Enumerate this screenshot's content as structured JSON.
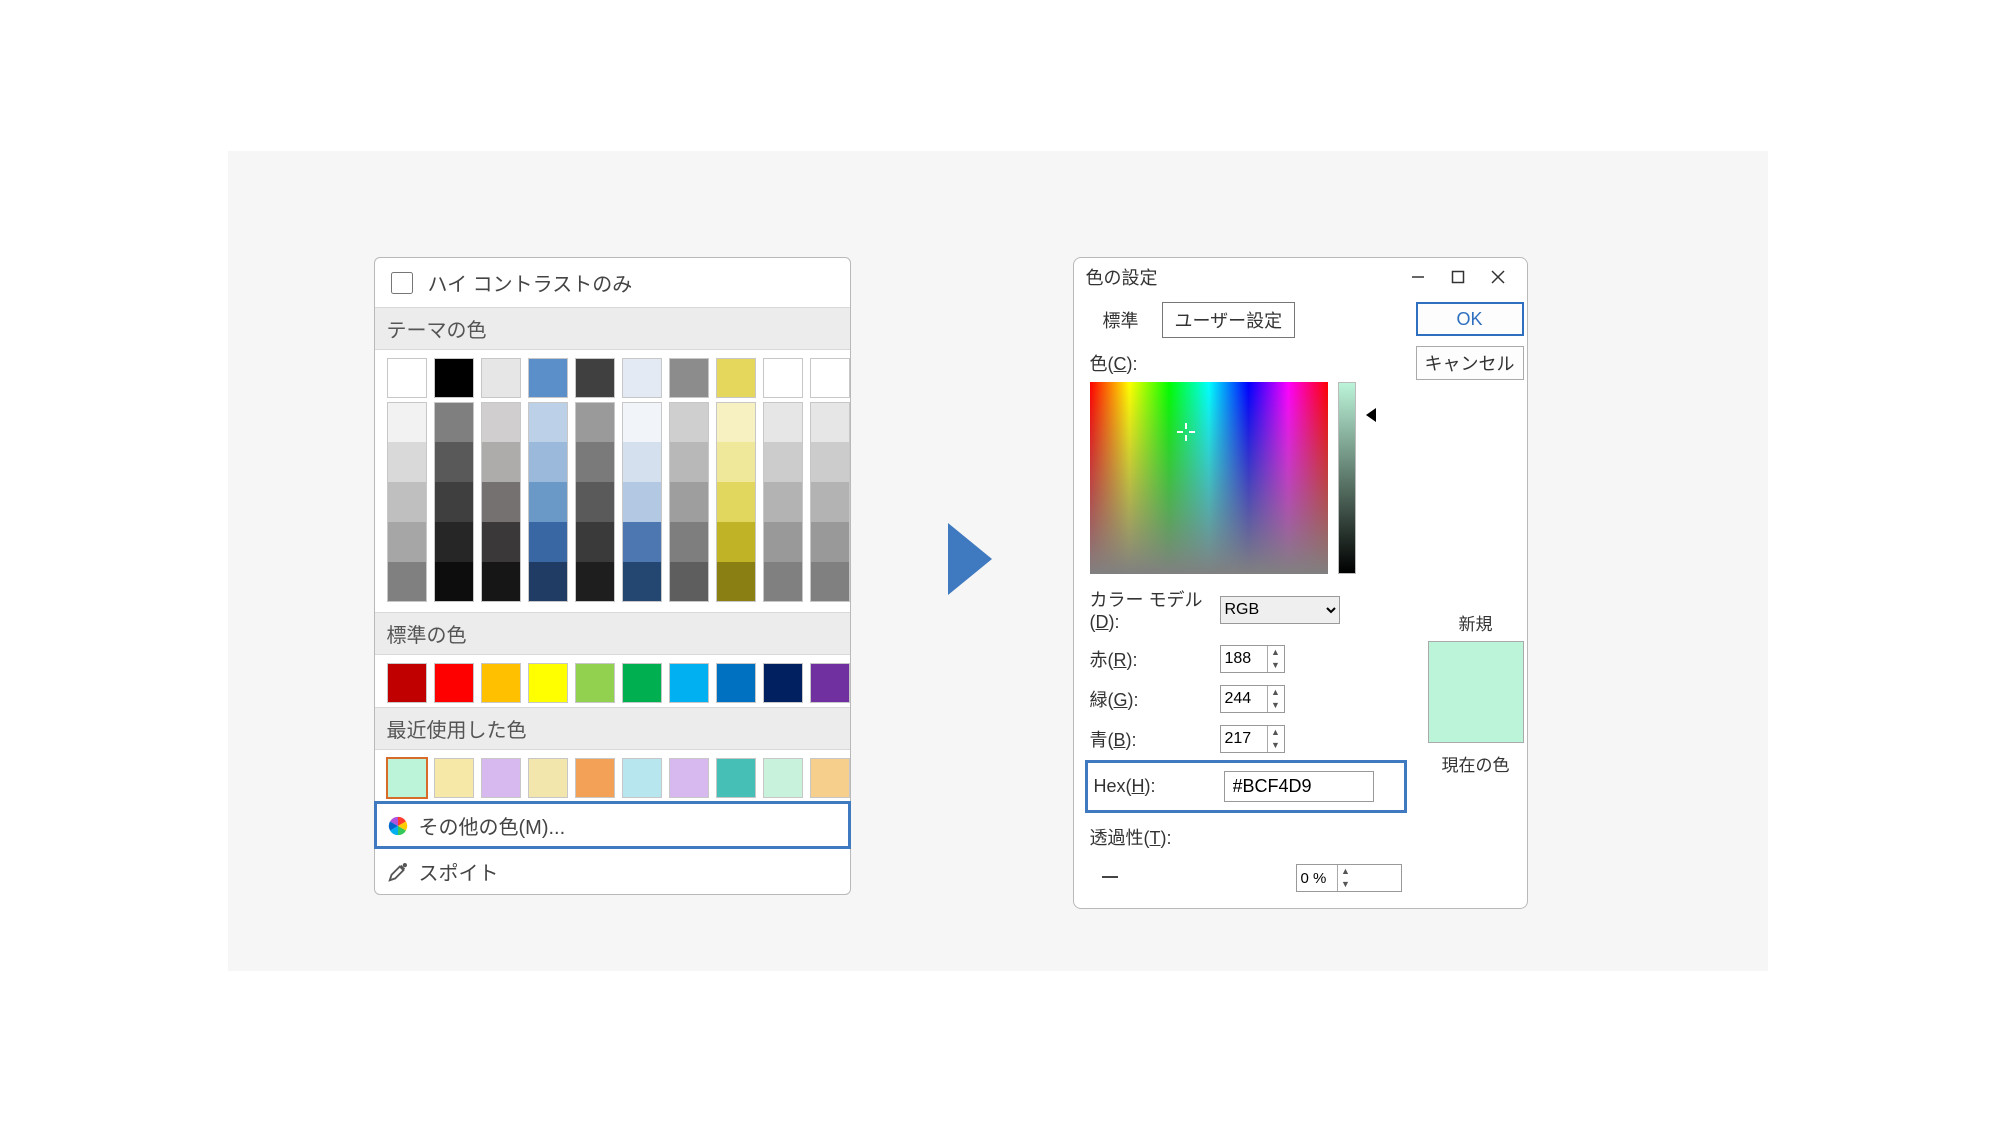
{
  "left_panel": {
    "high_contrast_label": "ハイ コントラストのみ",
    "theme_label": "テーマの色",
    "standard_label": "標準の色",
    "recent_label": "最近使用した色",
    "more_colors_label": "その他の色(M)...",
    "eyedropper_label": "スポイト",
    "theme_row": [
      "#ffffff",
      "#000000",
      "#e7e6e6",
      "#5b8fc9",
      "#404040",
      "#e3eaf3",
      "#8c8c8c",
      "#e5d75c",
      "#ffffff",
      "#ffffff"
    ],
    "theme_tints": [
      [
        "#f2f2f2",
        "#7f7f7f",
        "#d0cece",
        "#bcd0e8",
        "#9a9a9a",
        "#f1f5fa",
        "#cfcfcf",
        "#f7f0c0",
        "#e6e6e6",
        "#e6e6e6"
      ],
      [
        "#d9d9d9",
        "#595959",
        "#aeabab",
        "#9bb9db",
        "#7a7a7a",
        "#d5e0ef",
        "#b8b8b8",
        "#efe79a",
        "#cccccc",
        "#cccccc"
      ],
      [
        "#bfbfbf",
        "#3f3f3f",
        "#757171",
        "#6b99c7",
        "#5a5a5a",
        "#b3c8e2",
        "#9e9e9e",
        "#e2d75e",
        "#b3b3b3",
        "#b3b3b3"
      ],
      [
        "#a6a6a6",
        "#262626",
        "#3a3838",
        "#3967a3",
        "#3a3a3a",
        "#4d77b0",
        "#7e7e7e",
        "#c0b326",
        "#999999",
        "#999999"
      ],
      [
        "#808080",
        "#0d0d0d",
        "#161616",
        "#203b64",
        "#1e1e1e",
        "#234771",
        "#5e5e5e",
        "#8a7f12",
        "#808080",
        "#808080"
      ]
    ],
    "standard_colors": [
      "#c00000",
      "#ff0000",
      "#ffc000",
      "#ffff00",
      "#92d050",
      "#00b050",
      "#00b0f0",
      "#0070c0",
      "#002060",
      "#7030a0"
    ],
    "recent_colors": [
      "#bcf4d9",
      "#f6e9a8",
      "#d7b9ef",
      "#f3e6ad",
      "#f2a157",
      "#b8e6ef",
      "#d7b9ef",
      "#46bfb6",
      "#c8f2db",
      "#f6cf8c"
    ]
  },
  "dialog": {
    "title": "色の設定",
    "tabs": {
      "standard": "標準",
      "custom": "ユーザー設定"
    },
    "ok_label": "OK",
    "cancel_label": "キャンセル",
    "color_label": "色(C):",
    "model_label": "カラー モデル(D):",
    "model_value": "RGB",
    "red_label": "赤(R):",
    "green_label": "緑(G):",
    "blue_label": "青(B):",
    "red_value": "188",
    "green_value": "244",
    "blue_value": "217",
    "hex_label": "Hex(H):",
    "hex_value": "#BCF4D9",
    "transparency_label": "透過性(T):",
    "transparency_value": "0 %",
    "new_label": "新規",
    "current_label": "現在の色",
    "preview_color": "#bcf4d9"
  }
}
